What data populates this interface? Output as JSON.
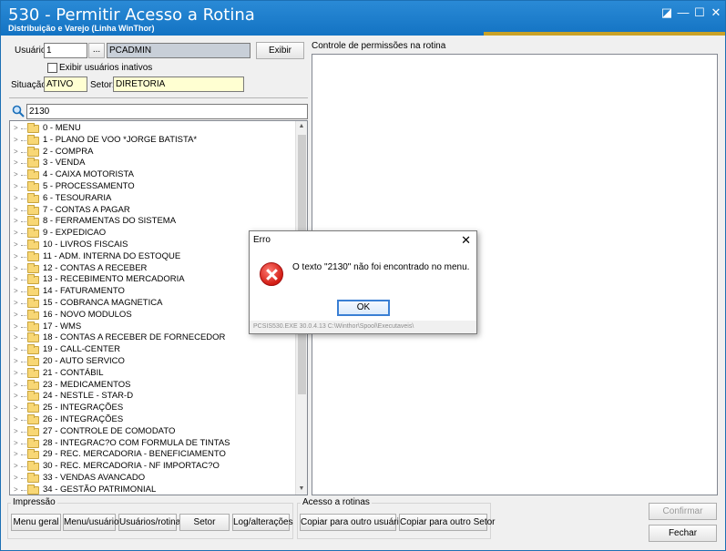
{
  "window": {
    "title": "530 - Permitir Acesso a Rotina",
    "subtitle": "Distribuição e Varejo (Linha WinThor)",
    "accent_color": "#c9a227",
    "titlebar_color": "#1a7acb",
    "controls": {
      "restore": "◪",
      "minimize": "—",
      "maximize": "☐",
      "close": "✕"
    }
  },
  "form": {
    "usuario_label": "Usuário:",
    "usuario_code": "1",
    "browse_label": "...",
    "usuario_name": "PCADMIN",
    "exibir_label": "Exibir",
    "exibir_inativos_label": "Exibir usuários inativos",
    "situacao_label": "Situação:",
    "situacao_value": "ATIVO",
    "setor_label": "Setor:",
    "setor_value": "DIRETORIA",
    "search_value": "2130",
    "permissions_title": "Controle de permissões na rotina"
  },
  "tree": {
    "items": [
      "0 - MENU",
      "1 - PLANO DE VOO *JORGE BATISTA*",
      "2 - COMPRA",
      "3 - VENDA",
      "4 - CAIXA MOTORISTA",
      "5 - PROCESSAMENTO",
      "6 - TESOURARIA",
      "7 - CONTAS A PAGAR",
      "8 - FERRAMENTAS DO SISTEMA",
      "9 - EXPEDICAO",
      "10 - LIVROS FISCAIS",
      "11 - ADM. INTERNA DO ESTOQUE",
      "12 - CONTAS A RECEBER",
      "13 - RECEBIMENTO MERCADORIA",
      "14 - FATURAMENTO",
      "15 - COBRANCA MAGNETICA",
      "16 - NOVO MODULOS",
      "17 - WMS",
      "18 - CONTAS A RECEBER DE FORNECEDOR",
      "19 - CALL-CENTER",
      "20 - AUTO SERVICO",
      "21 - CONTÁBIL",
      "23 - MEDICAMENTOS",
      "24 - NESTLE - STAR-D",
      "25 - INTEGRAÇÕES",
      "26 - INTEGRAÇÕES",
      "27 - CONTROLE DE COMODATO",
      "28 - INTEGRAC?O COM FORMULA DE TINTAS",
      "29 - REC. MERCADORIA - BENEFICIAMENTO",
      "30 - REC. MERCADORIA - NF IMPORTAC?O",
      "33 - VENDAS AVANCADO",
      "34 - GESTÃO PATRIMONIAL"
    ]
  },
  "impressao": {
    "title": "Impressão",
    "buttons": [
      "Menu geral",
      "Menu/usuário",
      "Usuários/rotina",
      "Setor",
      "Log/alterações"
    ]
  },
  "acesso": {
    "title": "Acesso a rotinas",
    "buttons": [
      "Copiar para outro usuário",
      "Copiar para outro Setor"
    ]
  },
  "actions": {
    "confirmar": "Confirmar",
    "fechar": "Fechar"
  },
  "dialog": {
    "title": "Erro",
    "message": "O texto \"2130\" não foi encontrado no menu.",
    "ok_label": "OK",
    "footer": "PCSIS530.EXE 30.0.4.13 C:\\Winthor\\Spool\\Executaveis\\"
  }
}
